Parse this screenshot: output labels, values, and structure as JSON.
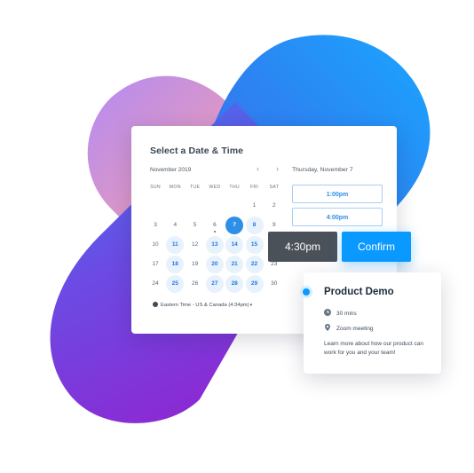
{
  "calendar": {
    "title": "Select a Date & Time",
    "month": "November 2019",
    "prev_icon": "‹",
    "next_icon": "›",
    "weekdays": [
      "SUN",
      "MON",
      "TUE",
      "WED",
      "THU",
      "FRI",
      "SAT"
    ],
    "weeks": [
      [
        "",
        "",
        "",
        "",
        "",
        "1",
        "2"
      ],
      [
        "3",
        "4",
        "5",
        "6",
        "7",
        "8",
        "9"
      ],
      [
        "10",
        "11",
        "12",
        "13",
        "14",
        "15",
        "16"
      ],
      [
        "17",
        "18",
        "19",
        "20",
        "21",
        "22",
        "23"
      ],
      [
        "24",
        "25",
        "26",
        "27",
        "28",
        "29",
        "30"
      ]
    ],
    "available": [
      "8",
      "11",
      "13",
      "14",
      "15",
      "18",
      "20",
      "21",
      "22",
      "25",
      "27",
      "28",
      "29"
    ],
    "selected": "7",
    "today": "6",
    "timezone": "Eastern Time - US & Canada (4:34pm)",
    "timezone_caret": "▾"
  },
  "times": {
    "date_heading": "Thursday, November 7",
    "slots": [
      "1:00pm",
      "4:00pm"
    ],
    "selected_time": "4:30pm",
    "confirm_label": "Confirm"
  },
  "event": {
    "title": "Product Demo",
    "duration": "30 mins",
    "location": "Zoom meeting",
    "description": "Learn more about how our product can work for you and your team!"
  },
  "colors": {
    "accent": "#0a99ff",
    "selected_day": "#2d8fe8",
    "available_day_bg": "#e8f2fd",
    "dark_button": "#4a5159"
  },
  "icons": {
    "timezone": "globe-icon",
    "duration": "clock-icon",
    "location": "location-pin-icon",
    "event_marker": "status-dot-icon"
  }
}
